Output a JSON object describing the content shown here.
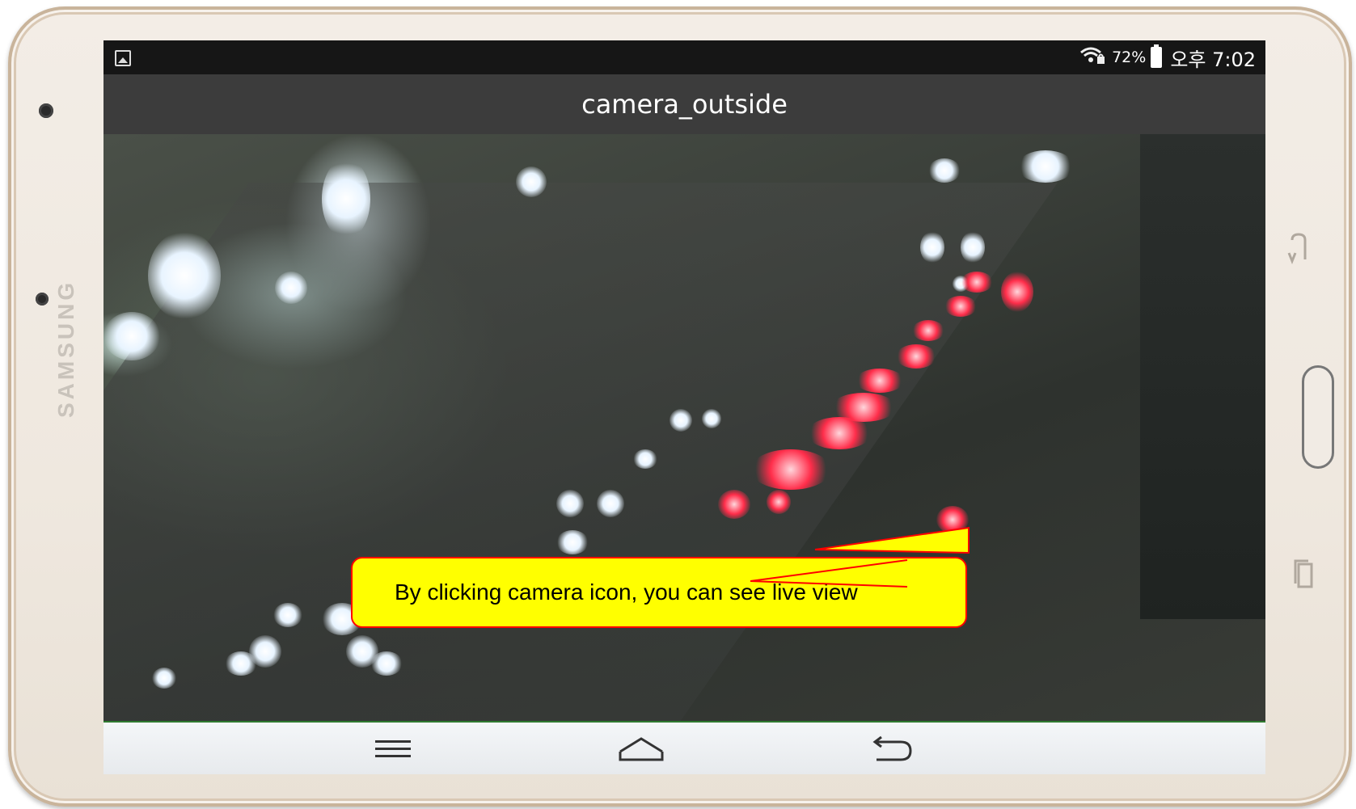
{
  "device": {
    "brand": "SAMSUNG"
  },
  "statusbar": {
    "battery_percent": "72%",
    "time": "오후 7:02",
    "wifi_icon": "wifi-lock-icon",
    "battery_icon": "battery-icon",
    "notification_icon": "gallery-icon"
  },
  "actionbar": {
    "title": "camera_outside"
  },
  "callout": {
    "text": "By clicking camera icon, you can see live view",
    "fill_color": "#ffff00",
    "border_color": "#ff0000"
  },
  "navbar": {
    "menu_icon": "menu-icon",
    "home_icon": "home-icon",
    "back_icon": "back-icon"
  }
}
